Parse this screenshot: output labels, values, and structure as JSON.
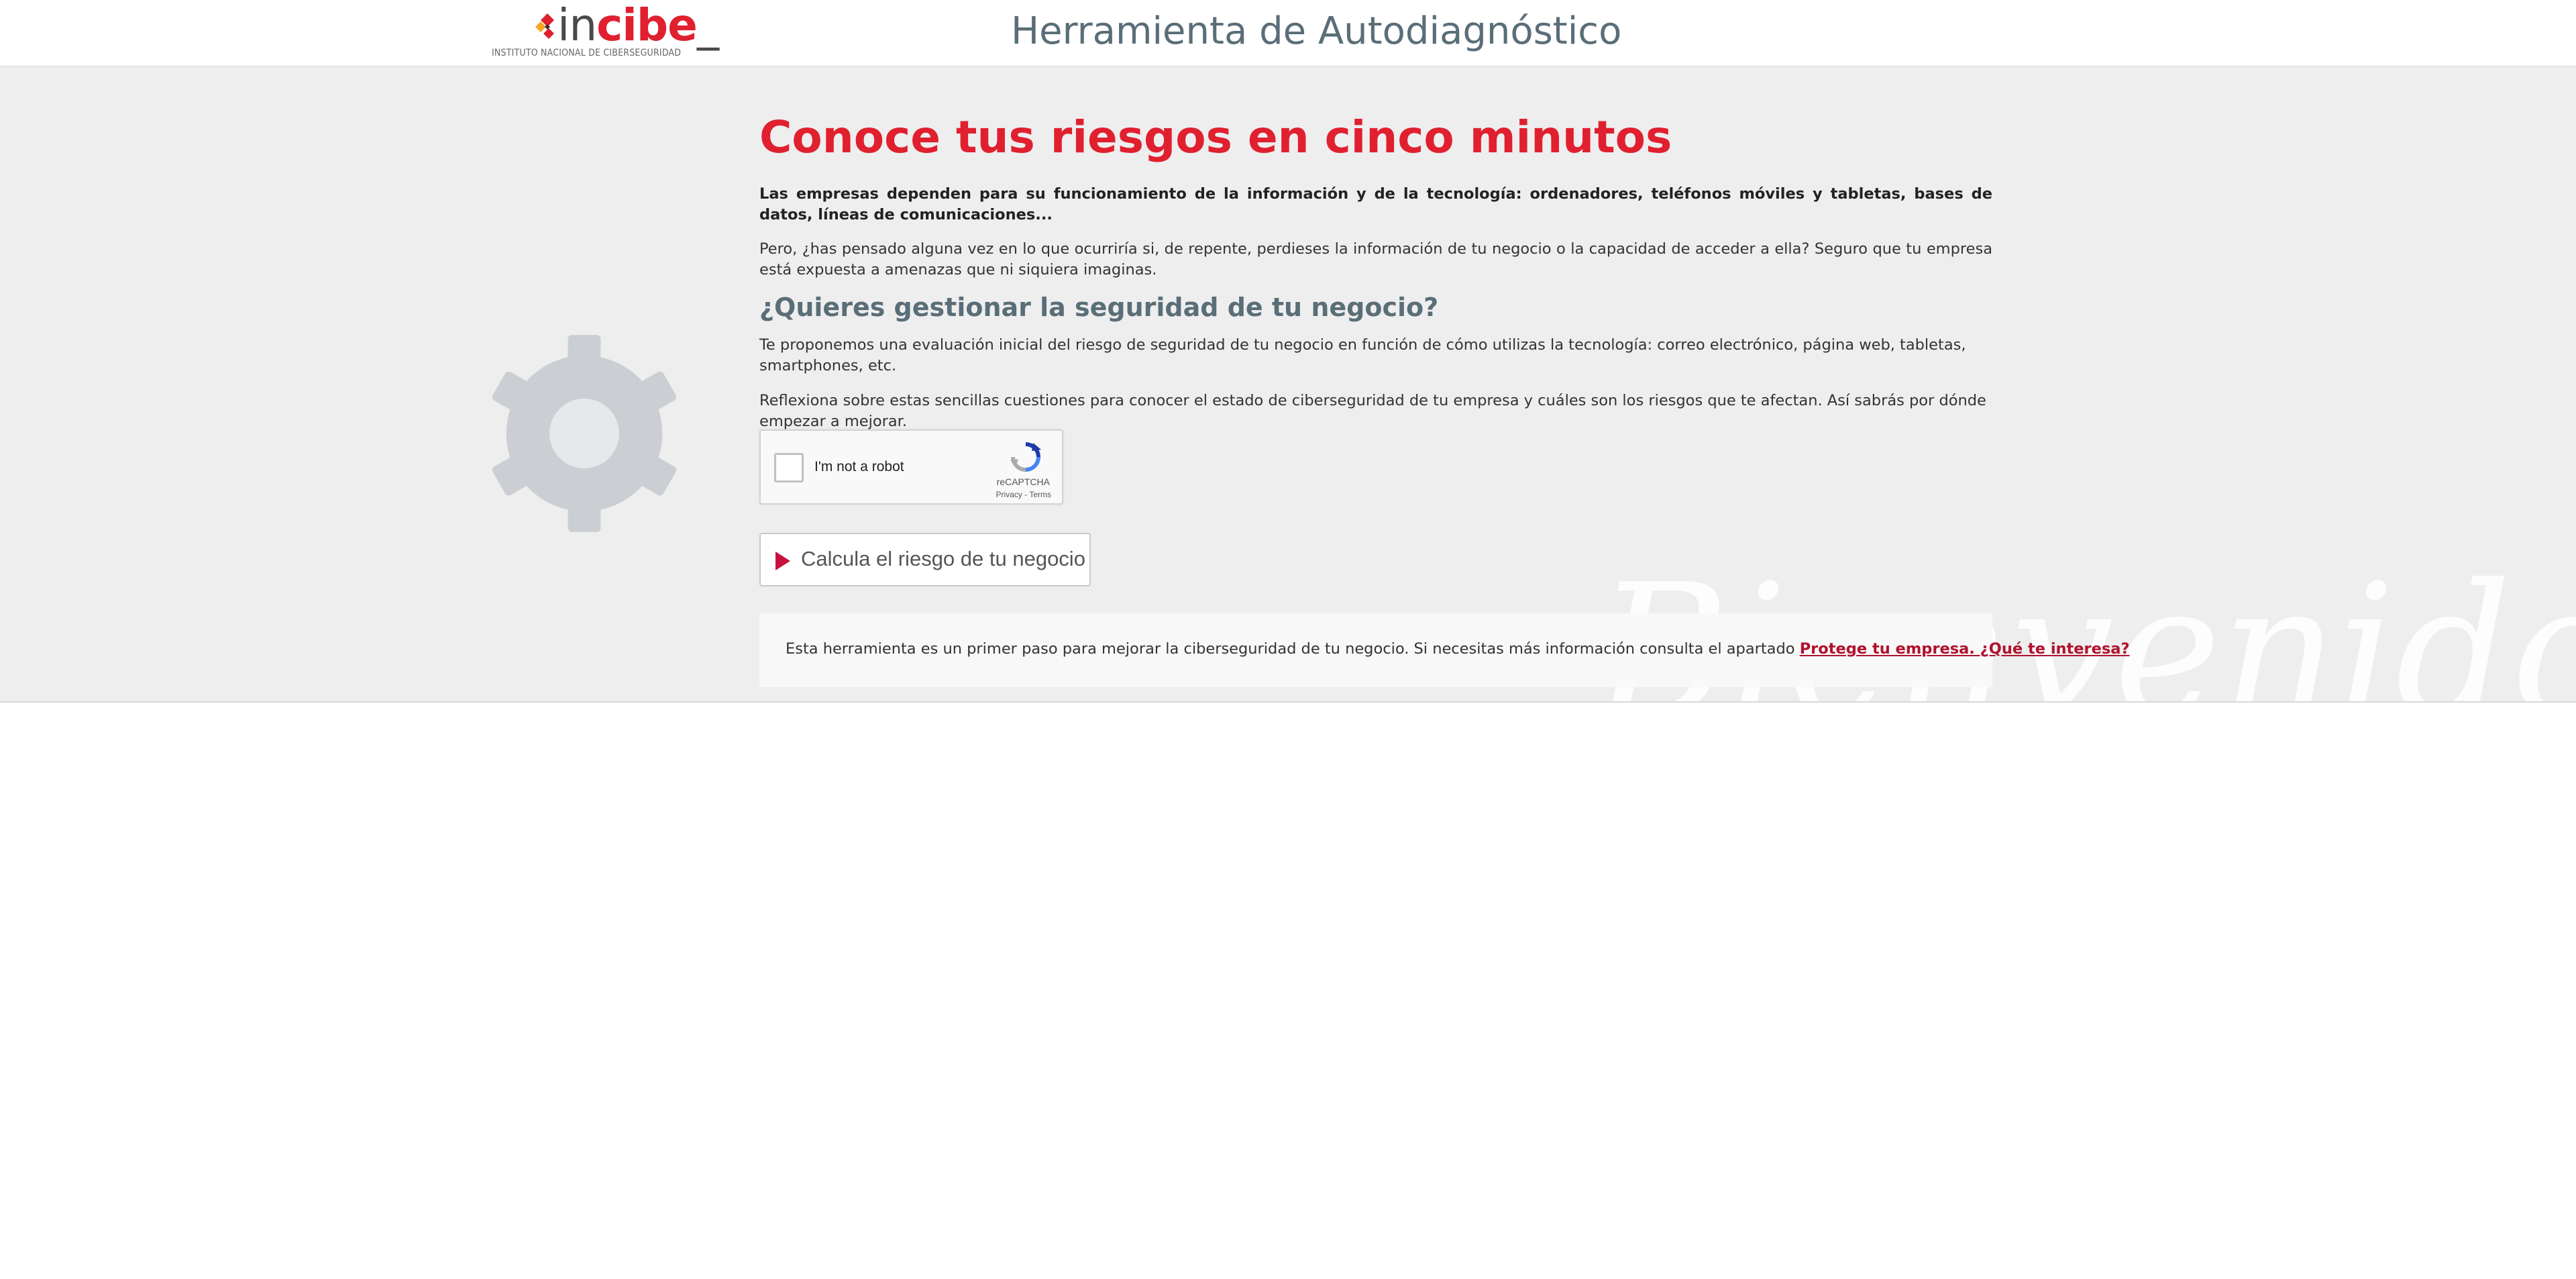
{
  "header": {
    "logo": {
      "text_in": "in",
      "text_cibe": "cibe",
      "text_underscore": "_",
      "subtitle": "INSTITUTO NACIONAL DE CIBERSEGURIDAD"
    },
    "title": "Herramienta de Autodiagnóstico"
  },
  "main": {
    "heading": "Conoce tus riesgos en cinco minutos",
    "lead": "Las empresas dependen para su funcionamiento de la información y de la tecnología: ordenadores, teléfonos móviles y tabletas, bases de datos, líneas de comunicaciones...",
    "intro": "Pero, ¿has pensado alguna vez en lo que ocurriría si, de repente, perdieses la información de tu negocio o la capacidad de acceder a ella? Seguro que tu empresa está expuesta a amenazas que ni siquiera imaginas.",
    "subheading": "¿Quieres gestionar la seguridad de tu negocio?",
    "paragraph1": "Te proponemos una evaluación inicial del riesgo de seguridad de tu negocio en función de cómo utilizas la tecnología: correo electrónico, página web, tabletas, smartphones, etc.",
    "paragraph2": "Reflexiona sobre estas sencillas cuestiones para conocer el estado de ciberseguridad de tu empresa y cuáles son los riesgos que te afectan. Así sabrás por dónde empezar a mejorar.",
    "watermark": "Bienvenido"
  },
  "captcha": {
    "label": "I'm not a robot",
    "brand": "reCAPTCHA",
    "privacy": "Privacy",
    "separator": " - ",
    "terms": "Terms"
  },
  "cta": {
    "label": "Calcula el riesgo de tu negocio"
  },
  "info": {
    "text": "Esta herramienta es un primer paso para mejorar la ciberseguridad de tu negocio. Si necesitas más información consulta el apartado ",
    "link": "Protege tu empresa. ¿Qué te interesa?"
  },
  "colors": {
    "brand_red": "#e0202f",
    "accent_crimson": "#c8103e",
    "title_slate": "#5a6e78",
    "band_grey": "#eeeeee"
  },
  "icons": {
    "logo_mark": "diamond-logo-icon",
    "gear": "gear-icon",
    "captcha_logo": "recaptcha-icon",
    "play": "play-icon"
  }
}
